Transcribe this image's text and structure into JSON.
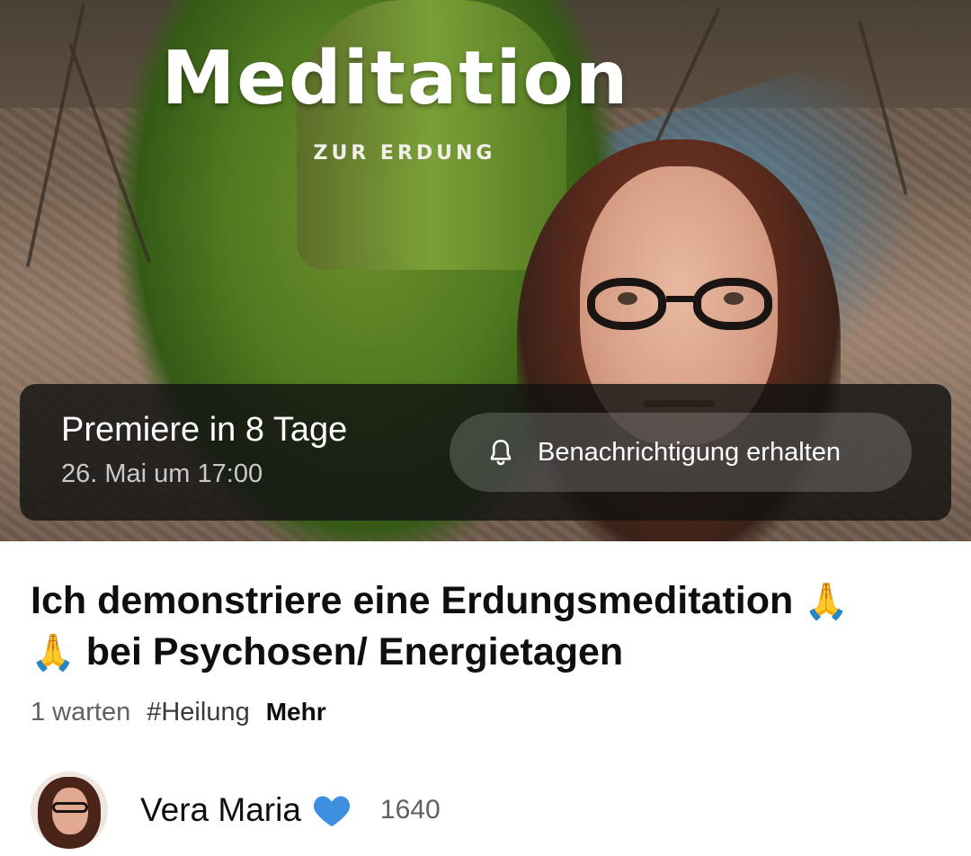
{
  "thumbnail": {
    "title_art": "Meditation",
    "subtitle_art": "ZUR ERDUNG"
  },
  "premiere": {
    "title": "Premiere in 8 Tage",
    "date": "26. Mai um 17:00",
    "notify_label": "Benachrichtigung erhalten",
    "notify_icon": "bell-icon"
  },
  "video": {
    "title_part1": "Ich demonstriere eine Erdungsmeditation",
    "title_part2": "bei Psychosen/ Energietagen",
    "emoji": "🙏",
    "waiting": "1 warten",
    "hashtag": "#Heilung",
    "more": "Mehr"
  },
  "channel": {
    "name": "Vera Maria",
    "badge_icon": "blue-heart-icon",
    "subscriber_count": "1640"
  },
  "colors": {
    "overlay": "#121212",
    "accent_heart": "#3d8fe0",
    "text_secondary": "#606060"
  }
}
